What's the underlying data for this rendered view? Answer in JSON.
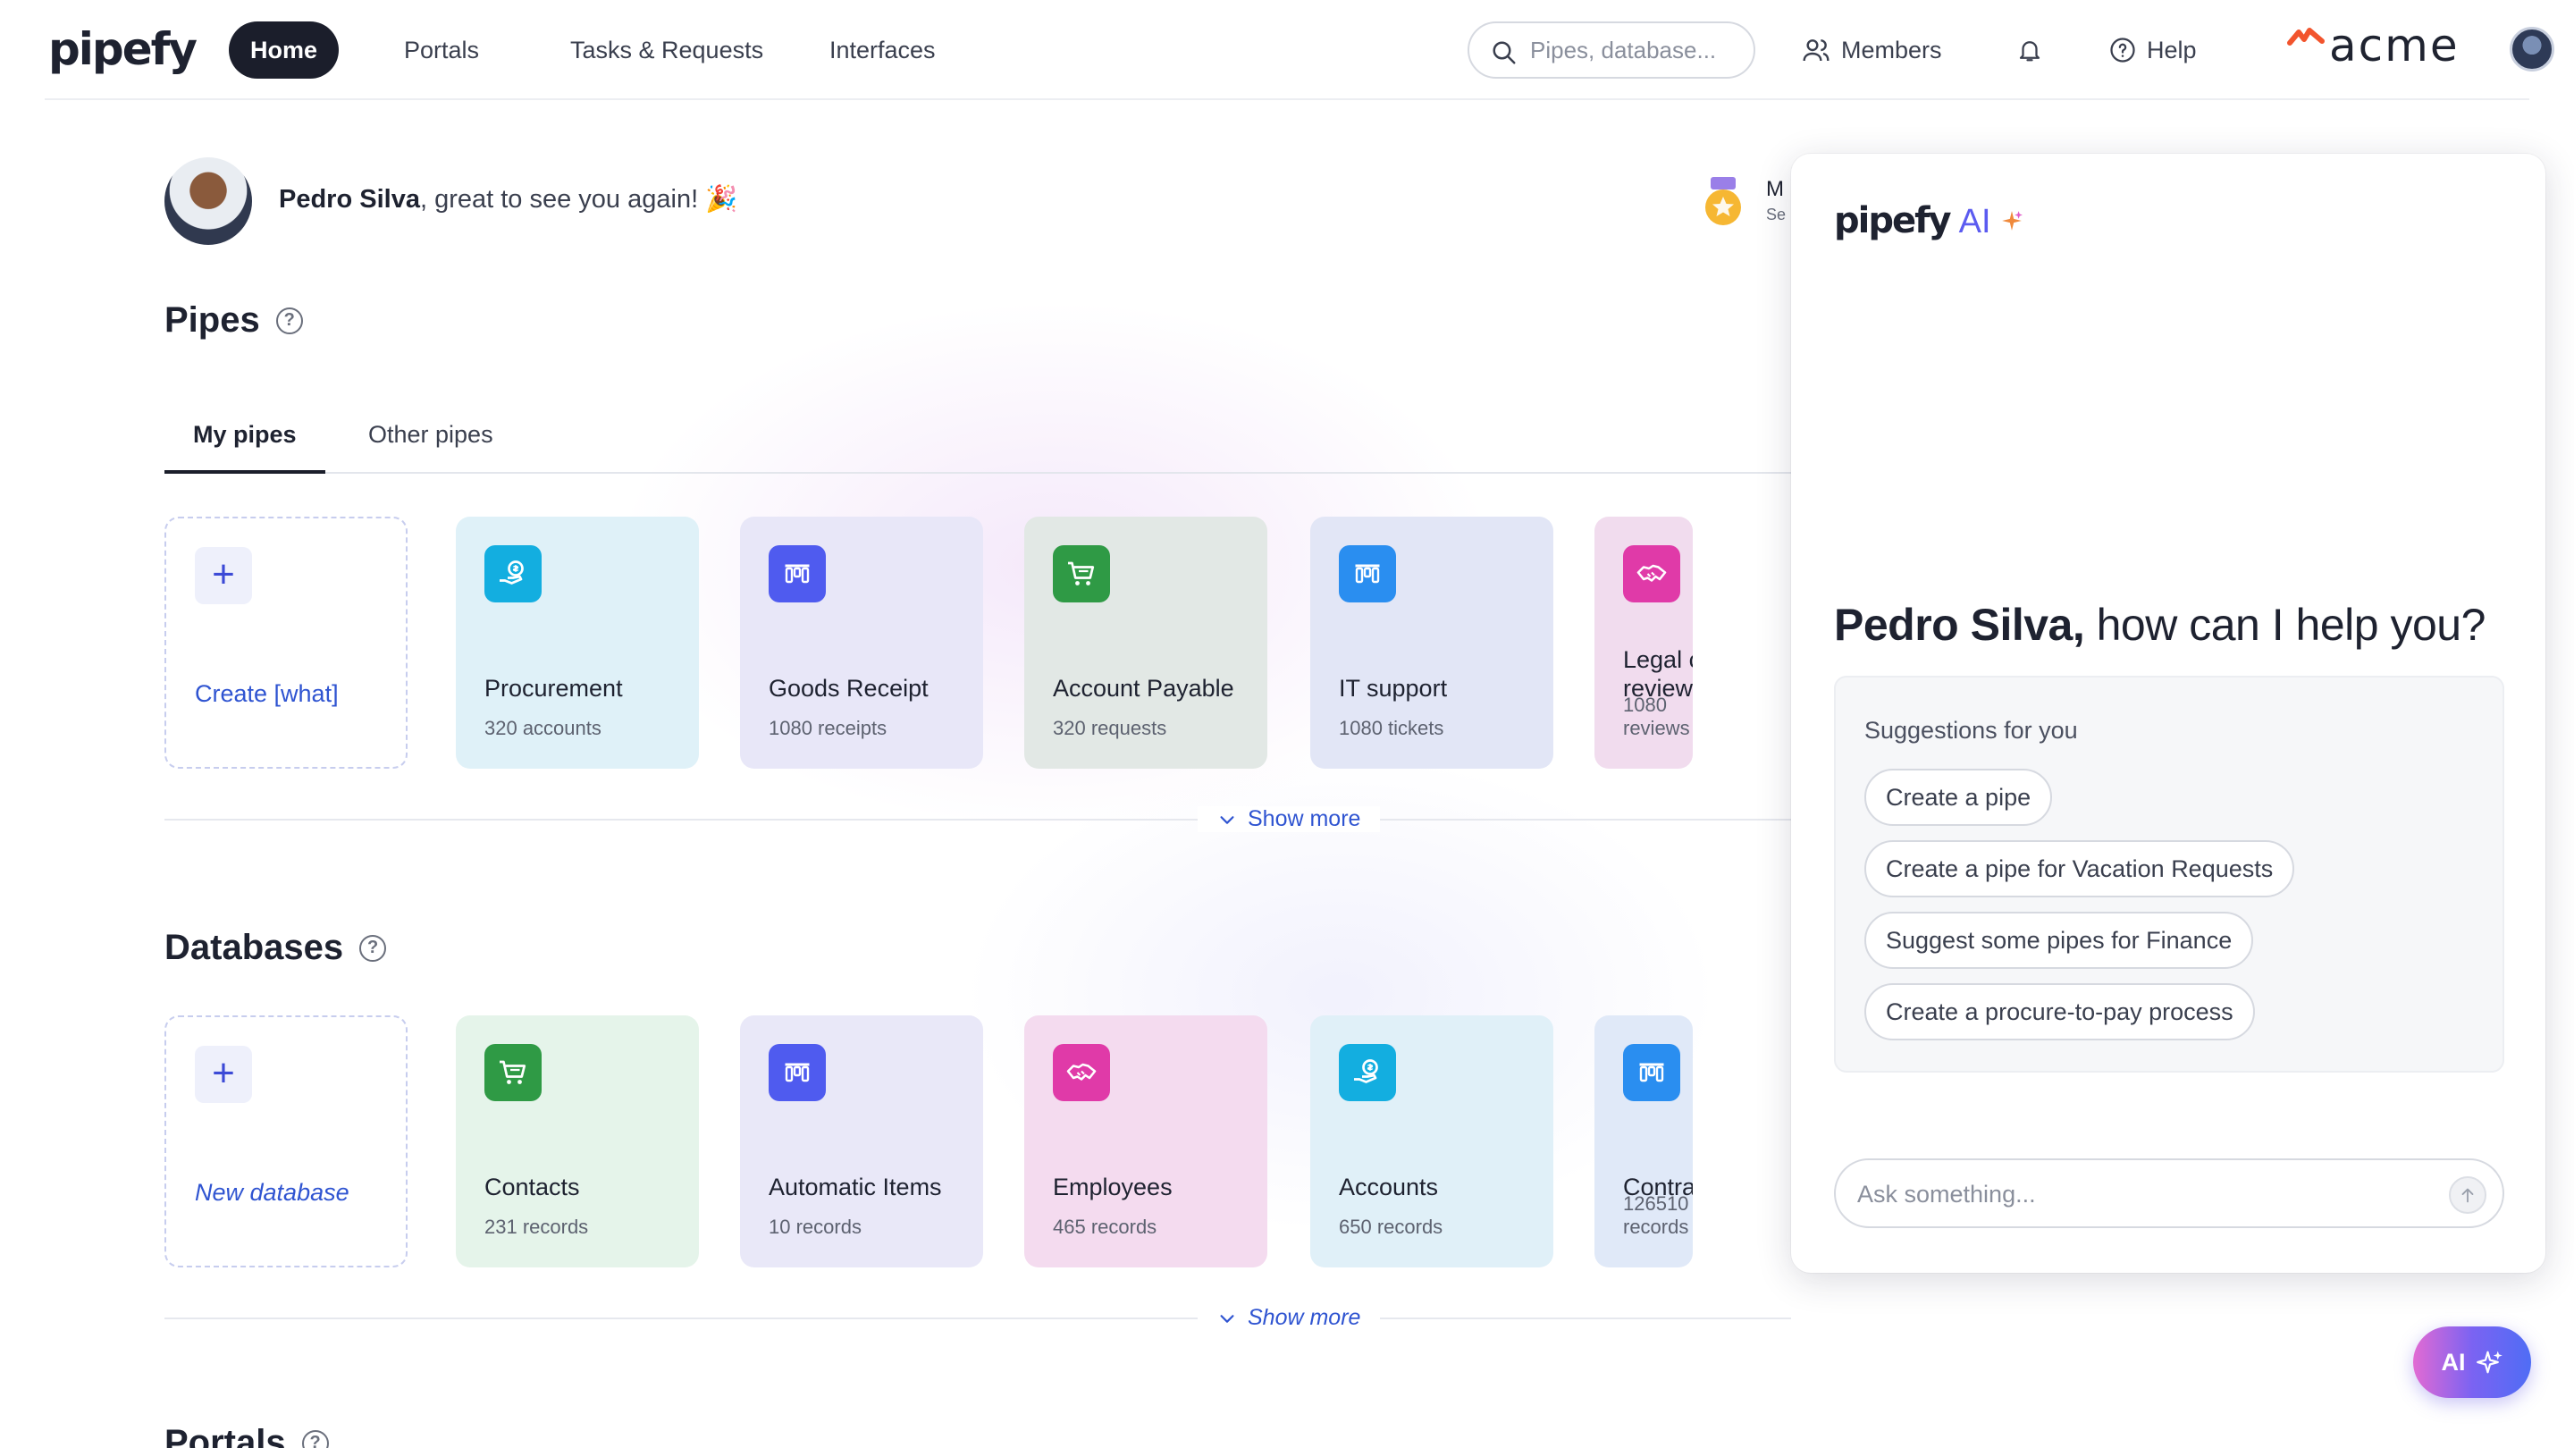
{
  "brand": {
    "logo": "pipefy",
    "tenant_logo": "acme"
  },
  "nav": {
    "items": [
      {
        "label": "Home",
        "active": true
      },
      {
        "label": "Portals",
        "active": false
      },
      {
        "label": "Tasks & Requests",
        "active": false
      },
      {
        "label": "Interfaces",
        "active": false
      }
    ],
    "search_placeholder": "Pipes, database...",
    "members_label": "Members",
    "help_label": "Help"
  },
  "greeting": {
    "name": "Pedro Silva",
    "message": ", great to see you again! 🎉"
  },
  "badge": {
    "title": "M",
    "subtitle": "Se"
  },
  "pipes": {
    "title": "Pipes",
    "tabs": [
      "My pipes",
      "Other pipes"
    ],
    "create_label": "Create [what]",
    "show_more": "Show more",
    "cards": [
      {
        "title": "Procurement",
        "subtitle": "320 accounts",
        "icon": "money-hand-icon",
        "icon_color": "#13aee0",
        "bg": "#dff1f8"
      },
      {
        "title": "Goods Receipt",
        "subtitle": "1080 receipts",
        "icon": "kanban-icon",
        "icon_color": "#4f5bef",
        "bg": "#e8e7f8"
      },
      {
        "title": "Account Payable",
        "subtitle": "320 requests",
        "icon": "cart-icon",
        "icon_color": "#2f9a45",
        "bg": "#e2e8e5"
      },
      {
        "title": "IT support",
        "subtitle": "1080 tickets",
        "icon": "kanban-icon",
        "icon_color": "#2a8ef0",
        "bg": "#e2e6f6"
      },
      {
        "title": "Legal contract review",
        "subtitle": "1080 reviews",
        "icon": "handshake-icon",
        "icon_color": "#e03aa8",
        "bg": "#f1dcee"
      }
    ]
  },
  "databases": {
    "title": "Databases",
    "create_label": "New database",
    "show_more": "Show more",
    "cards": [
      {
        "title": "Contacts",
        "subtitle": "231 records",
        "icon": "cart-icon",
        "icon_color": "#2f9a45",
        "bg": "#e5f4ea"
      },
      {
        "title": "Automatic Items",
        "subtitle": "10 records",
        "icon": "kanban-icon",
        "icon_color": "#4f5bef",
        "bg": "#e9e8f8"
      },
      {
        "title": "Employees",
        "subtitle": "465 records",
        "icon": "handshake-icon",
        "icon_color": "#e03aa8",
        "bg": "#f4dbef"
      },
      {
        "title": "Accounts",
        "subtitle": "650 records",
        "icon": "money-hand-icon",
        "icon_color": "#13aee0",
        "bg": "#e0f0f8"
      },
      {
        "title": "Contracts",
        "subtitle": "126510 records",
        "icon": "kanban-icon",
        "icon_color": "#2a8ef0",
        "bg": "#e0e9f8"
      }
    ]
  },
  "portals": {
    "title": "Portals"
  },
  "ai_panel": {
    "brand": "pipefy",
    "brand_ai": "AI",
    "greeting_name": "Pedro Silva,",
    "greeting_rest": " how can I help you?",
    "suggestions_label": "Suggestions for you",
    "suggestions": [
      "Create a pipe",
      "Create a pipe for Vacation Requests",
      "Suggest some pipes for Finance",
      "Create a procure-to-pay process"
    ],
    "ask_placeholder": "Ask something...",
    "fab_label": "AI"
  }
}
